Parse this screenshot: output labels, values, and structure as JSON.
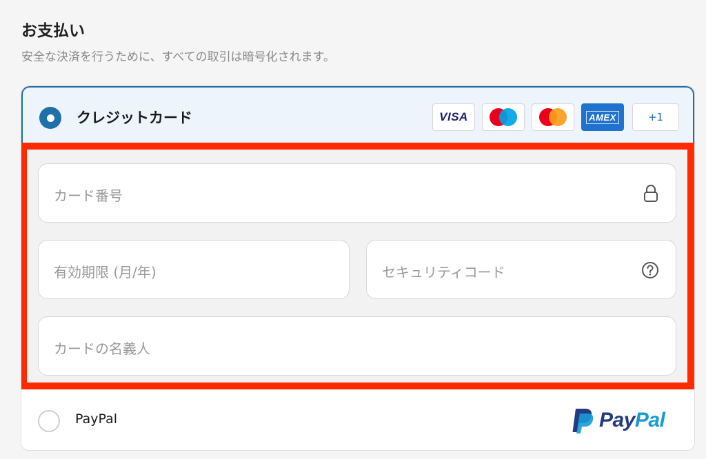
{
  "header": {
    "title": "お支払い",
    "subtitle": "安全な決済を行うために、すべての取引は暗号化されます。"
  },
  "credit_card": {
    "label": "クレジットカード",
    "selected": true,
    "brands": {
      "visa": "VISA",
      "maestro": "maestro-icon",
      "mastercard": "mastercard-icon",
      "amex": "AMEX",
      "more": "+1"
    },
    "fields": {
      "card_number_placeholder": "カード番号",
      "expiry_placeholder": "有効期限 (月/年)",
      "security_code_placeholder": "セキュリティコード",
      "cardholder_placeholder": "カードの名義人"
    }
  },
  "paypal": {
    "label": "PayPal",
    "selected": false,
    "logo_text": "PayPal"
  },
  "colors": {
    "accent": "#1f6fa8",
    "highlight_border": "#ff2a00",
    "paypal_dark": "#253b80",
    "paypal_light": "#179bd7"
  }
}
